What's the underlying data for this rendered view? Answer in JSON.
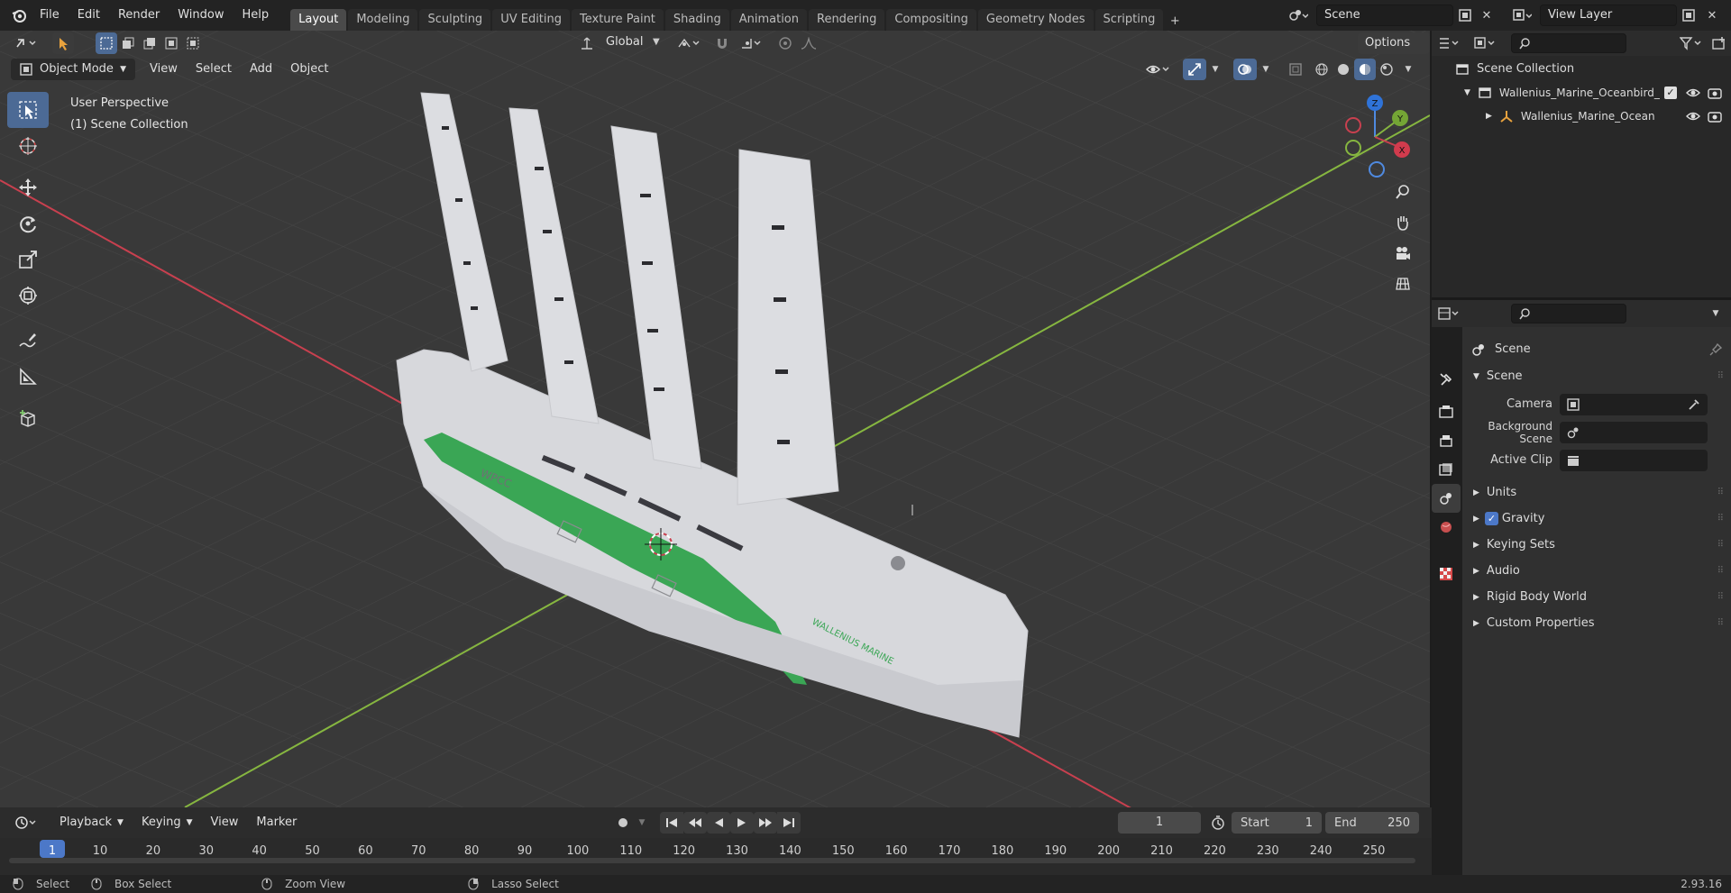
{
  "menubar": {
    "items": [
      "File",
      "Edit",
      "Render",
      "Window",
      "Help"
    ],
    "workspaces": [
      "Layout",
      "Modeling",
      "Sculpting",
      "UV Editing",
      "Texture Paint",
      "Shading",
      "Animation",
      "Rendering",
      "Compositing",
      "Geometry Nodes",
      "Scripting"
    ],
    "active_workspace": "Layout",
    "scene_value": "Scene",
    "view_layer_value": "View Layer"
  },
  "viewport_header": {
    "mode": "Object Mode",
    "menus": [
      "View",
      "Select",
      "Add",
      "Object"
    ],
    "transform_orientation": "Global",
    "options_label": "Options"
  },
  "viewport": {
    "perspective_label": "User Perspective",
    "collection_label": "(1) Scene Collection",
    "gizmo": {
      "x": "X",
      "y": "Y",
      "z": "Z"
    }
  },
  "outliner": {
    "root": "Scene Collection",
    "items": [
      "Wallenius_Marine_Oceanbird_",
      "Wallenius_Marine_Ocean"
    ]
  },
  "properties": {
    "context_label": "Scene",
    "panel_title": "Scene",
    "camera_label": "Camera",
    "background_scene_label": "Background Scene",
    "active_clip_label": "Active Clip",
    "sections": [
      "Units",
      "Gravity",
      "Keying Sets",
      "Audio",
      "Rigid Body World",
      "Custom Properties"
    ],
    "gravity_checked": true
  },
  "timeline": {
    "menus": [
      "Playback",
      "Keying",
      "View",
      "Marker"
    ],
    "current_frame": "1",
    "start_label": "Start",
    "start_value": "1",
    "end_label": "End",
    "end_value": "250",
    "ruler": [
      "1",
      "10",
      "20",
      "30",
      "40",
      "50",
      "60",
      "70",
      "80",
      "90",
      "100",
      "110",
      "120",
      "130",
      "140",
      "150",
      "160",
      "170",
      "180",
      "190",
      "200",
      "210",
      "220",
      "230",
      "240",
      "250"
    ]
  },
  "statusbar": {
    "select": "Select",
    "box_select": "Box Select",
    "zoom_view": "Zoom View",
    "lasso_select": "Lasso Select",
    "version": "2.93.16"
  },
  "colors": {
    "accent": "#4c6a95",
    "x_axis": "#c8404f",
    "y_axis": "#86b640",
    "hull_stripe": "#3aa655"
  }
}
